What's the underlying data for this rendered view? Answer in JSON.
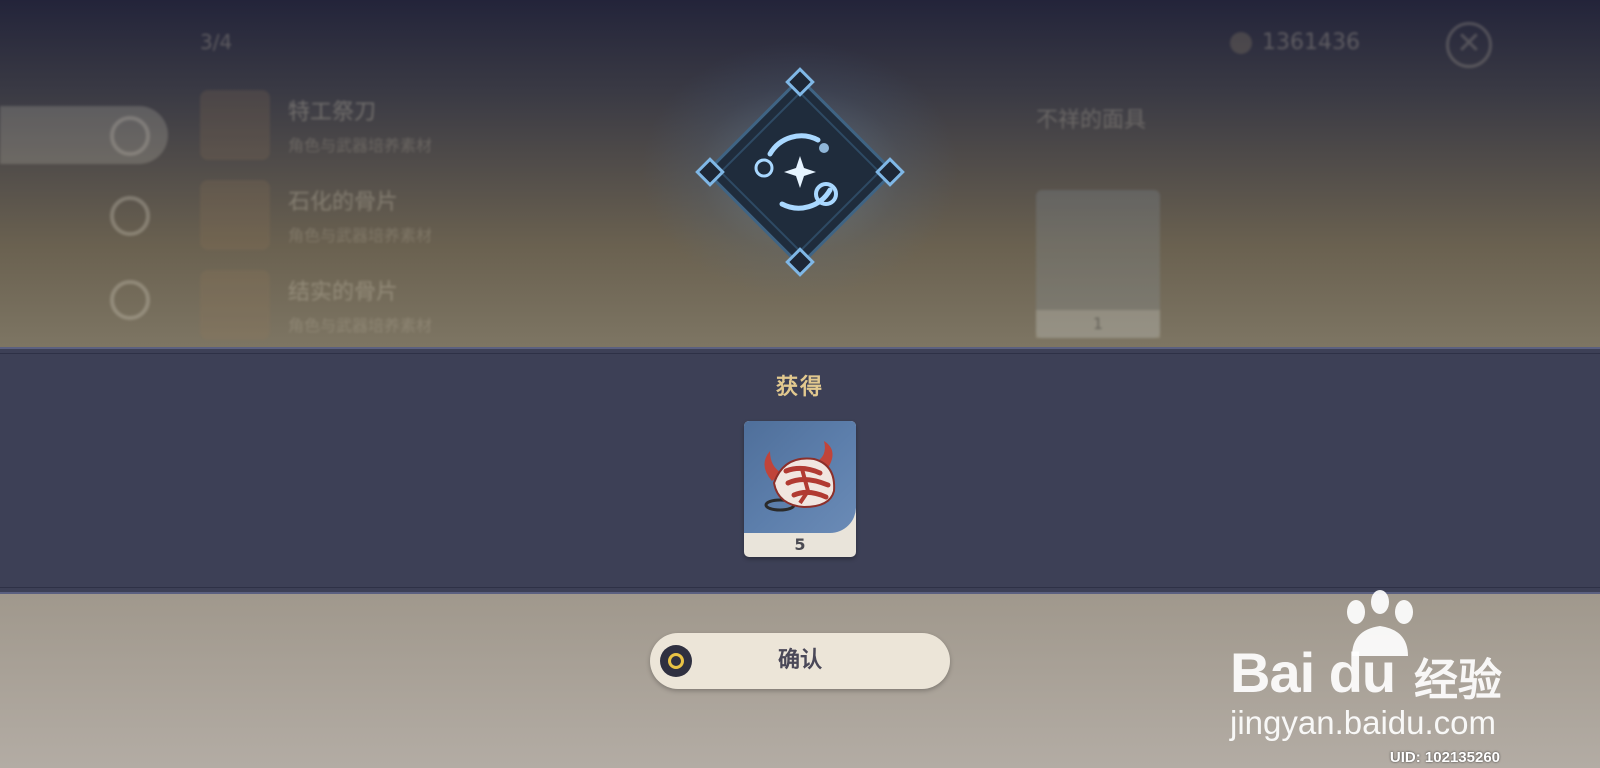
{
  "background": {
    "top_label": "3/4",
    "coin_value": "1361436",
    "close_icon": "close-icon",
    "list_items": [
      {
        "name": "特工祭刀",
        "category": "角色与武器培养素材"
      },
      {
        "name": "石化的骨片",
        "category": "角色与武器培养素材"
      },
      {
        "name": "结实的骨片",
        "category": "角色与武器培养素材"
      }
    ],
    "detail_title": "不祥的面具",
    "detail_count": "1"
  },
  "reward": {
    "title": "获得",
    "item_icon": "ominous-mask-icon",
    "item_count": "5"
  },
  "confirm": {
    "label": "确认",
    "icon": "circle-button-icon"
  },
  "watermark": {
    "brand_latin": "Bai du",
    "brand_cn": "经验",
    "url": "jingyan.baidu.com"
  },
  "uid": "UID: 102135260",
  "colors": {
    "band": "#3d4056",
    "title_gold": "#e2c98f",
    "button_bg": "#ece5d8",
    "emblem_blue": "#9fd3ff"
  }
}
